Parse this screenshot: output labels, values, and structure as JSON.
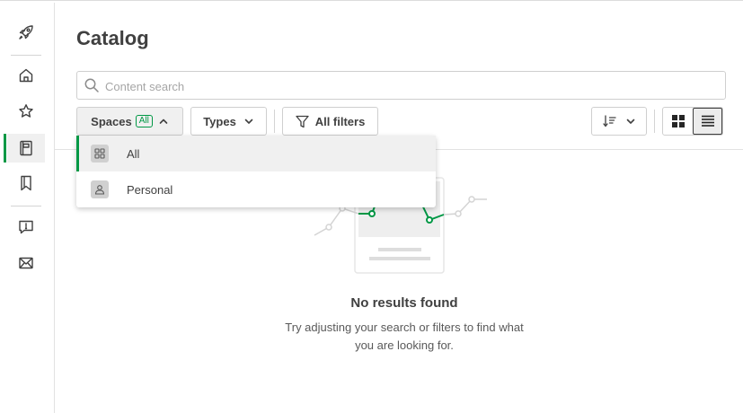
{
  "page": {
    "title": "Catalog"
  },
  "search": {
    "placeholder": "Content search"
  },
  "filters": {
    "spaces_label": "Spaces",
    "spaces_badge": "All",
    "types_label": "Types",
    "all_filters_label": "All filters"
  },
  "sidebar": {
    "items": [
      {
        "icon": "rocket-icon"
      },
      {
        "icon": "home-icon"
      },
      {
        "icon": "star-icon"
      },
      {
        "icon": "catalog-icon",
        "active": true
      },
      {
        "icon": "bookmark-icon"
      },
      {
        "icon": "feedback-icon"
      },
      {
        "icon": "mail-icon"
      }
    ]
  },
  "spaces_dropdown": {
    "items": [
      {
        "label": "All",
        "icon": "grid-icon",
        "selected": true
      },
      {
        "label": "Personal",
        "icon": "person-icon",
        "selected": false
      }
    ]
  },
  "view": {
    "active": "list"
  },
  "empty_state": {
    "title": "No results found",
    "description_line1": "Try adjusting your search or filters to find what",
    "description_line2": "you are looking for."
  },
  "colors": {
    "accent": "#009845",
    "text": "#404040",
    "border": "#cfcfcf"
  }
}
